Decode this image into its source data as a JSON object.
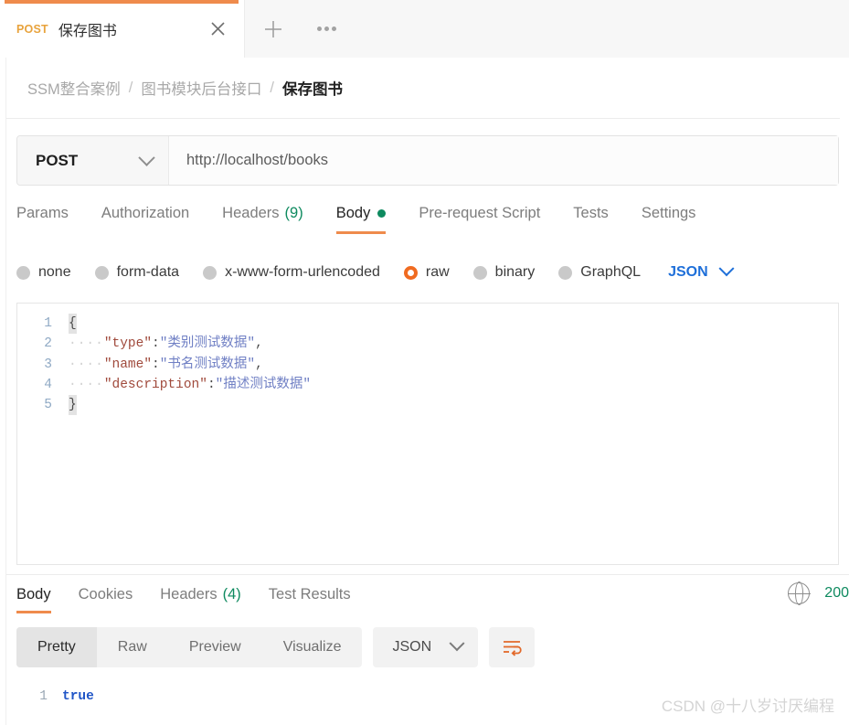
{
  "tab": {
    "method": "POST",
    "title": "保存图书",
    "close_icon": "close-icon",
    "new_tab_icon": "plus-icon",
    "more_icon": "more-horizontal-icon"
  },
  "breadcrumb": {
    "items": [
      "SSM整合案例",
      "图书模块后台接口"
    ],
    "separator": "/",
    "current": "保存图书"
  },
  "url_bar": {
    "method": "POST",
    "method_chevron_icon": "chevron-down-icon",
    "url": "http://localhost/books"
  },
  "request_tabs": [
    {
      "label": "Params",
      "active": false
    },
    {
      "label": "Authorization",
      "active": false
    },
    {
      "label": "Headers",
      "count": "(9)",
      "active": false
    },
    {
      "label": "Body",
      "active": true,
      "dot": true
    },
    {
      "label": "Pre-request Script",
      "active": false
    },
    {
      "label": "Tests",
      "active": false
    },
    {
      "label": "Settings",
      "active": false
    }
  ],
  "body_types": [
    {
      "label": "none",
      "selected": false
    },
    {
      "label": "form-data",
      "selected": false
    },
    {
      "label": "x-www-form-urlencoded",
      "selected": false
    },
    {
      "label": "raw",
      "selected": true
    },
    {
      "label": "binary",
      "selected": false
    },
    {
      "label": "GraphQL",
      "selected": false
    }
  ],
  "body_format": {
    "value": "JSON",
    "chevron_icon": "chevron-down-icon"
  },
  "request_body": {
    "language": "JSON",
    "lines": [
      {
        "no": "1",
        "indent": "",
        "brace": "{",
        "key": "",
        "value": "",
        "comma": ""
      },
      {
        "no": "2",
        "indent": "····",
        "key": "\"type\"",
        "colon": ":",
        "value": "\"类别测试数据\"",
        "comma": ","
      },
      {
        "no": "3",
        "indent": "····",
        "key": "\"name\"",
        "colon": ":",
        "value": "\"书名测试数据\"",
        "comma": ","
      },
      {
        "no": "4",
        "indent": "····",
        "key": "\"description\"",
        "colon": ":",
        "value": "\"描述测试数据\"",
        "comma": ""
      },
      {
        "no": "5",
        "indent": "",
        "brace": "}",
        "key": "",
        "value": "",
        "comma": ""
      }
    ]
  },
  "response_tabs": [
    {
      "label": "Body",
      "active": true
    },
    {
      "label": "Cookies",
      "active": false
    },
    {
      "label": "Headers",
      "count": "(4)",
      "active": false
    },
    {
      "label": "Test Results",
      "active": false
    }
  ],
  "response_meta": {
    "globe_icon": "globe-icon",
    "status": "200"
  },
  "response_toolbar": {
    "views": [
      {
        "label": "Pretty",
        "selected": true
      },
      {
        "label": "Raw",
        "selected": false
      },
      {
        "label": "Preview",
        "selected": false
      },
      {
        "label": "Visualize",
        "selected": false
      }
    ],
    "format": "JSON",
    "format_chevron_icon": "chevron-down-icon",
    "wrap_icon": "word-wrap-icon"
  },
  "response_body": {
    "lines": [
      {
        "no": "1",
        "value": "true"
      }
    ]
  },
  "watermark": "CSDN @十八岁讨厌编程",
  "colors": {
    "accent_orange": "#ef8b4c",
    "method_orange": "#e8a33d",
    "green": "#0e8a5f",
    "blue_link": "#1e6fd9",
    "json_key": "#a04a3c",
    "json_string": "#6f7fc4",
    "bool_blue": "#2156c7"
  }
}
